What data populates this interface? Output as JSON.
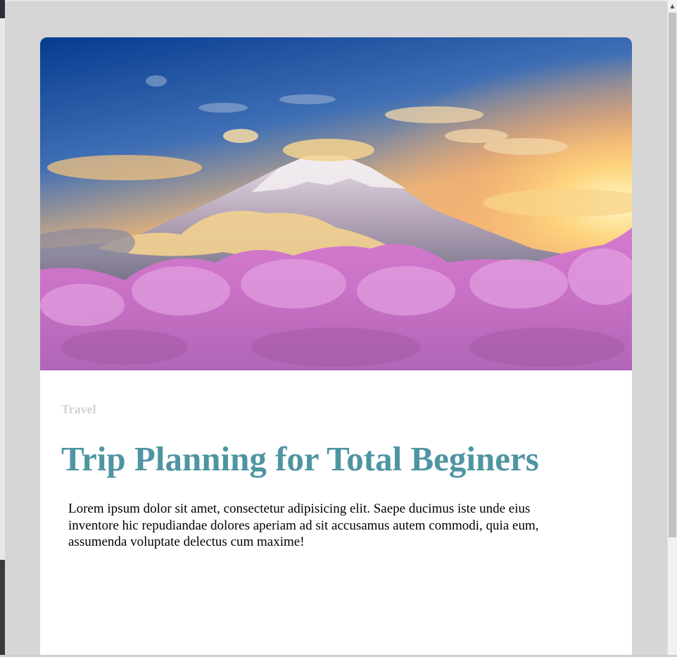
{
  "window": {
    "scroll_up_icon": "triangle-up"
  },
  "article": {
    "hero_image": "mount-fuji-cherry-blossoms",
    "category": "Travel",
    "title": "Trip Planning for Total Beginers",
    "body": "Lorem ipsum dolor sit amet, consectetur adipisicing elit. Saepe ducimus iste unde eius inventore hic repudiandae dolores aperiam ad sit accusamus autem commodi, quia eum, assumenda voluptate delectus cum maxime!"
  },
  "colors": {
    "page_bg": "#d6d6d6",
    "card_bg": "#ffffff",
    "title": "#4e95a1",
    "category": "#d3d3d3"
  }
}
